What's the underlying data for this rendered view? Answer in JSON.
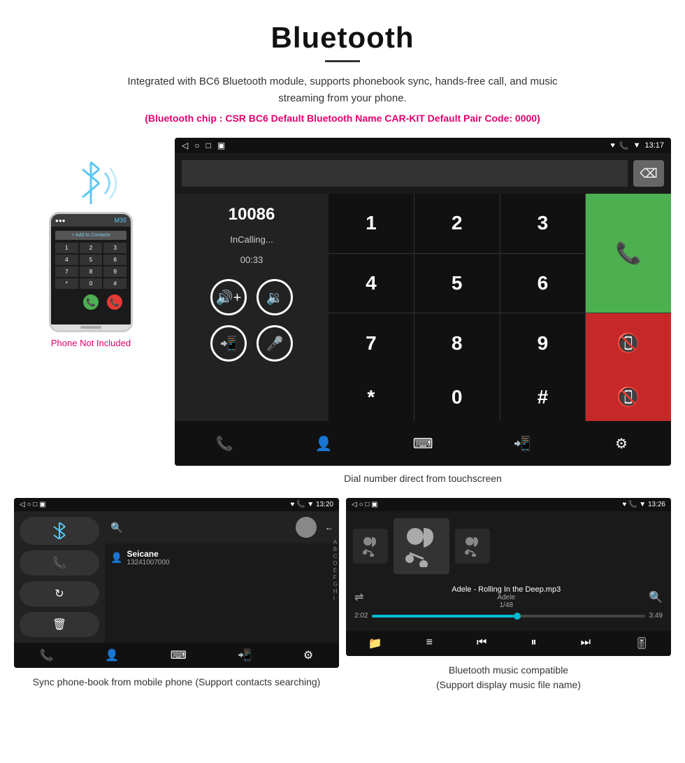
{
  "page": {
    "title": "Bluetooth",
    "description": "Integrated with BC6 Bluetooth module, supports phonebook sync, hands-free call, and music streaming from your phone.",
    "specs": "(Bluetooth chip : CSR BC6    Default Bluetooth Name CAR-KIT    Default Pair Code: 0000)",
    "divider_visible": true
  },
  "main_screen": {
    "status_bar": {
      "left_icons": [
        "◁",
        "○",
        "□",
        "▣"
      ],
      "right_icons": [
        "♥",
        "📞",
        "▼",
        "13:17"
      ]
    },
    "call": {
      "number": "10086",
      "status": "InCalling...",
      "timer": "00:33"
    },
    "dialpad": {
      "keys": [
        "1",
        "2",
        "3",
        "4",
        "5",
        "6",
        "7",
        "8",
        "9",
        "*",
        "0",
        "#"
      ]
    },
    "caption": "Dial number direct from touchscreen"
  },
  "phone_mockup": {
    "not_included": "Phone Not Included"
  },
  "phonebook_screen": {
    "status_bar": {
      "time": "13:20",
      "right": "♥ 📞 ▼"
    },
    "contact": {
      "name": "Seicane",
      "number": "13241007000"
    },
    "alphabet": [
      "A",
      "B",
      "C",
      "D",
      "E",
      "F",
      "G",
      "H",
      "I"
    ],
    "caption": "Sync phone-book from mobile phone\n(Support contacts searching)"
  },
  "music_screen": {
    "status_bar": {
      "time": "13:26",
      "right": "♥ 📞 ▼"
    },
    "song": {
      "title": "Adele - Rolling In the Deep.mp3",
      "artist": "Adele",
      "track": "1/48"
    },
    "progress": {
      "current": "2:02",
      "total": "3:49",
      "percent": 52
    },
    "caption": "Bluetooth music compatible\n(Support display music file name)"
  },
  "colors": {
    "accent_pink": "#e0006e",
    "green": "#4CAF50",
    "red": "#c62828",
    "android_bg": "#111111",
    "android_mid": "#222222"
  }
}
